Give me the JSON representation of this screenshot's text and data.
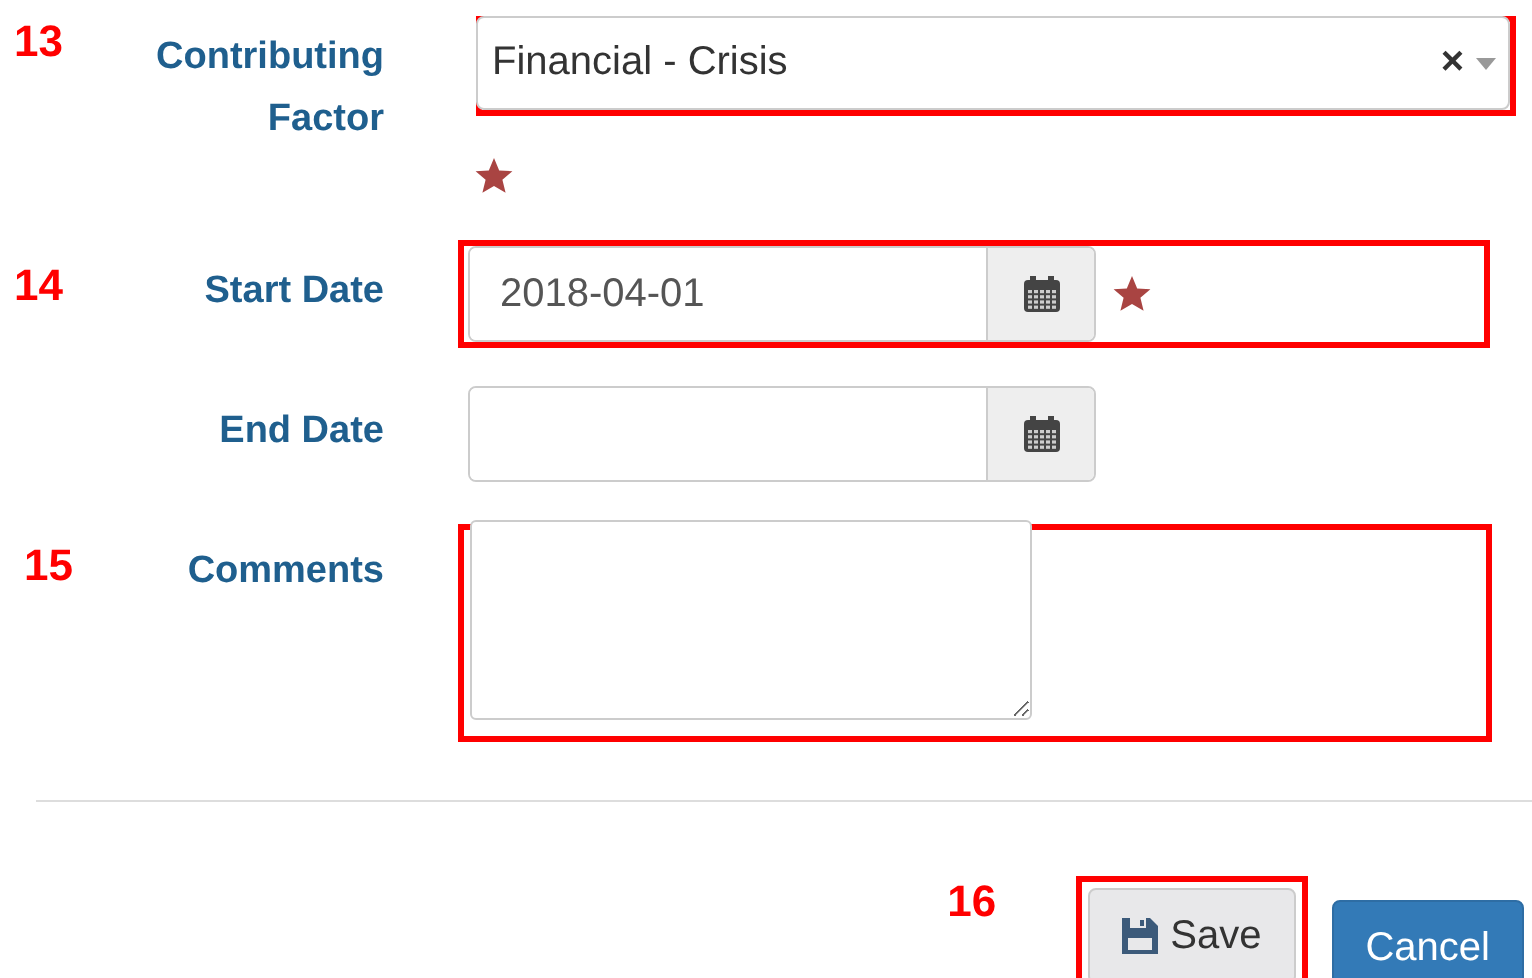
{
  "rows": [
    {
      "kind": "select",
      "label": "Contributing Factor",
      "callout": "13",
      "highlighted": true,
      "value": "Financial - Crisis",
      "clear": "×",
      "required": true
    },
    {
      "kind": "date",
      "label": "Start Date",
      "callout": "14",
      "highlighted": true,
      "value": "2018-04-01",
      "required": true
    },
    {
      "kind": "date",
      "label": "End Date",
      "highlighted": false,
      "required": false
    },
    {
      "kind": "textarea",
      "label": "Comments",
      "callout": "15",
      "highlighted": true,
      "required": false
    }
  ],
  "buttons": [
    {
      "kind": "save",
      "label": "Save",
      "callout": "16",
      "highlighted": true
    },
    {
      "kind": "cancel",
      "label": "Cancel",
      "highlighted": false
    }
  ]
}
